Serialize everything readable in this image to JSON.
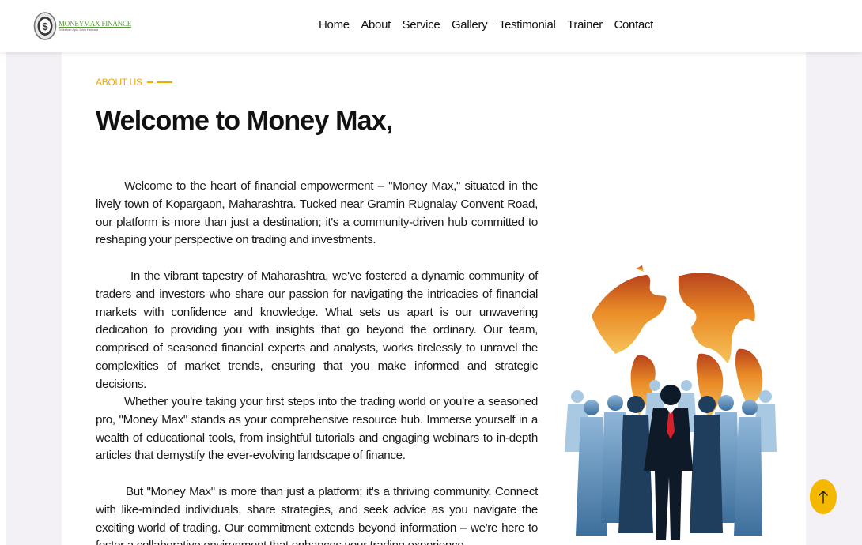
{
  "brand": {
    "name": "MONEYMAX FINANCE",
    "tagline": "Shikshan Apla Dahi Hamara"
  },
  "nav": {
    "items": [
      {
        "label": "Home"
      },
      {
        "label": "About"
      },
      {
        "label": "Service"
      },
      {
        "label": "Gallery"
      },
      {
        "label": "Testimonial"
      },
      {
        "label": "Trainer"
      },
      {
        "label": "Contact"
      }
    ]
  },
  "about": {
    "eyebrow": "ABOUT US",
    "title": "Welcome to Money Max,",
    "paragraphs": [
      "Welcome to the heart of financial empowerment – \"Money Max,\" situated in the lively town of Kopargaon, Maharashtra. Tucked near Gramin Rugnalay Convent Road, our platform is more than just a destination; it's a community-driven hub committed to reshaping your perspective on trading and investments.",
      "In the vibrant tapestry of Maharashtra, we've fostered a dynamic community of traders and investors who share our passion for navigating the intricacies of financial markets with confidence and knowledge. What sets us apart is our unwavering dedication to providing you with insights that go beyond the ordinary. Our team, comprised of seasoned financial experts and analysts, works tirelessly to unravel the complexities of market trends, ensuring that you make informed and strategic decisions.",
      "Whether you're taking your first steps into the trading world or you're a seasoned pro, \"Money Max\" stands as your comprehensive resource hub. Immerse yourself in a wealth of educational tools, from insightful tutorials and engaging webinars to in-depth articles that demystify the ever-evolving landscape of finance.",
      "But \"Money Max\" is more than just a platform; it's a thriving community. Connect with like-minded individuals, share strategies, and seek advice as you navigate the exciting world of trading. Our commitment extends beyond information – we're here to foster a collaborative environment that enhances your trading experience."
    ]
  },
  "colors": {
    "accent": "#f2a900",
    "scroll_button": "#f5b800",
    "logo_green": "#5b9a3a"
  },
  "icons": {
    "scroll_top": "arrow-up-icon",
    "logo": "dollar-coin-icon"
  }
}
